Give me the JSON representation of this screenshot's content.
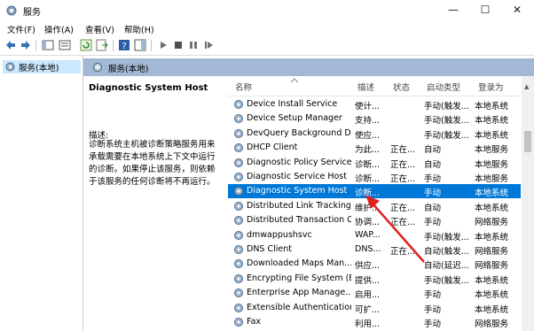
{
  "window": {
    "title": "服务",
    "minimize": "—",
    "maximize": "☐",
    "close": "✕"
  },
  "menu": [
    "文件(F)",
    "操作(A)",
    "查看(V)",
    "帮助(H)"
  ],
  "tree": {
    "item": "服务(本地)"
  },
  "panel": {
    "header": "服务(本地)"
  },
  "details": {
    "service_name": "Diagnostic System Host",
    "desc_label": "描述:",
    "desc_text": "诊断系统主机被诊断策略服务用来承载需要在本地系统上下文中运行的诊断。如果停止该服务，则依赖于该服务的任何诊断将不再运行。"
  },
  "columns": {
    "name": "名称",
    "desc": "描述",
    "status": "状态",
    "startup": "启动类型",
    "logon": "登录为"
  },
  "rows": [
    {
      "name": "Device Install Service",
      "desc": "使计...",
      "status": "",
      "startup": "手动(触发...",
      "logon": "本地系统"
    },
    {
      "name": "Device Setup Manager",
      "desc": "支持...",
      "status": "",
      "startup": "手动(触发...",
      "logon": "本地系统"
    },
    {
      "name": "DevQuery Background D...",
      "desc": "使应...",
      "status": "",
      "startup": "手动(触发...",
      "logon": "本地系统"
    },
    {
      "name": "DHCP Client",
      "desc": "为此...",
      "status": "正在...",
      "startup": "自动",
      "logon": "本地服务"
    },
    {
      "name": "Diagnostic Policy Service",
      "desc": "诊断...",
      "status": "正在...",
      "startup": "自动",
      "logon": "本地服务"
    },
    {
      "name": "Diagnostic Service Host",
      "desc": "诊断...",
      "status": "正在...",
      "startup": "手动",
      "logon": "本地服务"
    },
    {
      "name": "Diagnostic System Host",
      "desc": "诊断...",
      "status": "",
      "startup": "手动",
      "logon": "本地系统"
    },
    {
      "name": "Distributed Link Tracking...",
      "desc": "维护...",
      "status": "正在...",
      "startup": "自动",
      "logon": "本地系统"
    },
    {
      "name": "Distributed Transaction C...",
      "desc": "协调...",
      "status": "正在...",
      "startup": "手动",
      "logon": "网络服务"
    },
    {
      "name": "dmwappushsvc",
      "desc": "WAP...",
      "status": "",
      "startup": "手动(触发...",
      "logon": "本地系统"
    },
    {
      "name": "DNS Client",
      "desc": "DNS...",
      "status": "正在...",
      "startup": "自动(触发...",
      "logon": "网络服务"
    },
    {
      "name": "Downloaded Maps Man...",
      "desc": "供应...",
      "status": "",
      "startup": "自动(延迟...",
      "logon": "网络服务"
    },
    {
      "name": "Encrypting File System (E...",
      "desc": "提供...",
      "status": "",
      "startup": "手动(触发...",
      "logon": "本地系统"
    },
    {
      "name": "Enterprise App Manage...",
      "desc": "启用...",
      "status": "",
      "startup": "手动",
      "logon": "本地系统"
    },
    {
      "name": "Extensible Authentication...",
      "desc": "可扩...",
      "status": "",
      "startup": "手动",
      "logon": "本地系统"
    },
    {
      "name": "Fax",
      "desc": "利用...",
      "status": "",
      "startup": "手动",
      "logon": "网络服务"
    }
  ],
  "selected_index": 6,
  "colors": {
    "selection": "#0078d7",
    "header": "#a3b8d4",
    "tree_selection": "#cce8ff",
    "arrow": "#e02020"
  }
}
